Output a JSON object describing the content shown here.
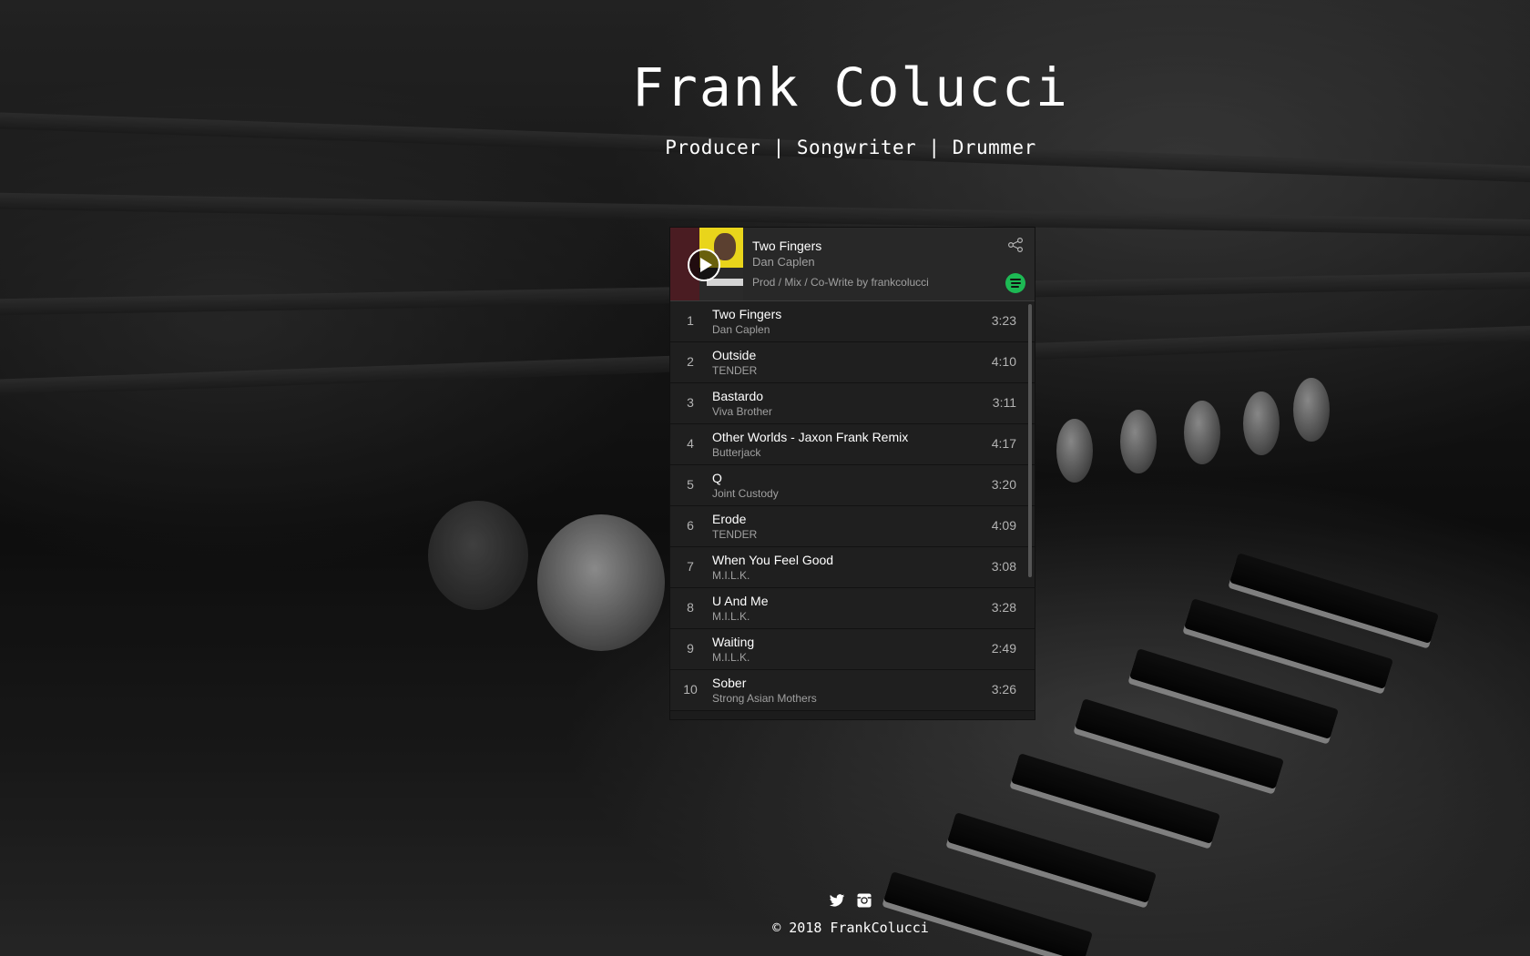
{
  "hero": {
    "title": "Frank Colucci",
    "subtitle": "Producer | Songwriter | Drummer"
  },
  "player": {
    "now_playing": {
      "title": "Two Fingers",
      "artist": "Dan Caplen",
      "credit": "Prod / Mix / Co-Write by frankcolucci"
    },
    "tracks": [
      {
        "num": "1",
        "title": "Two Fingers",
        "artist": "Dan Caplen",
        "duration": "3:23"
      },
      {
        "num": "2",
        "title": "Outside",
        "artist": "TENDER",
        "duration": "4:10"
      },
      {
        "num": "3",
        "title": "Bastardo",
        "artist": "Viva Brother",
        "duration": "3:11"
      },
      {
        "num": "4",
        "title": "Other Worlds - Jaxon Frank Remix",
        "artist": "Butterjack",
        "duration": "4:17"
      },
      {
        "num": "5",
        "title": "Q",
        "artist": "Joint Custody",
        "duration": "3:20"
      },
      {
        "num": "6",
        "title": "Erode",
        "artist": "TENDER",
        "duration": "4:09"
      },
      {
        "num": "7",
        "title": "When You Feel Good",
        "artist": "M.I.L.K.",
        "duration": "3:08"
      },
      {
        "num": "8",
        "title": "U And Me",
        "artist": "M.I.L.K.",
        "duration": "3:28"
      },
      {
        "num": "9",
        "title": "Waiting",
        "artist": "M.I.L.K.",
        "duration": "2:49"
      },
      {
        "num": "10",
        "title": "Sober",
        "artist": "Strong Asian Mothers",
        "duration": "3:26"
      }
    ],
    "icons": {
      "share": "share-icon",
      "spotify": "spotify-icon",
      "play": "play-icon"
    },
    "colors": {
      "spotify_green": "#1db954",
      "panel": "#282828",
      "list_bg": "#1f1f1f"
    }
  },
  "footer": {
    "icons": [
      "twitter-icon",
      "instagram-icon"
    ],
    "copyright": "© 2018 FrankColucci"
  }
}
